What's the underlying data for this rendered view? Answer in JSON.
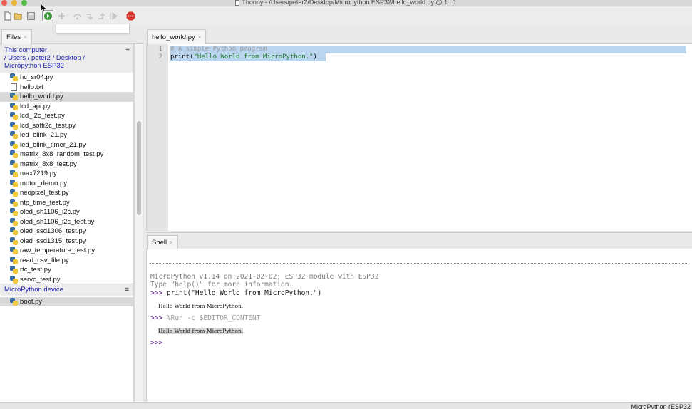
{
  "window": {
    "title": "Thonny  -  /Users/peter2/Desktop/Micropython ESP32/hello_world.py  @  1 : 1"
  },
  "toolbar": {
    "buttons": [
      "new-file-icon",
      "open-file-icon",
      "save-icon",
      "run-icon",
      "debug-icon",
      "step-over-icon",
      "step-into-icon",
      "step-out-icon",
      "resume-icon",
      "stop-icon"
    ],
    "stop_label": "STOP"
  },
  "files_panel": {
    "tab_label": "Files",
    "close_glyph": "×",
    "menu_glyph": "≡",
    "this_computer": "This computer",
    "path": "/ Users / peter2 / Desktop /",
    "path2": "Micropython ESP32",
    "files": [
      {
        "name": "hc_sr04.py",
        "type": "py"
      },
      {
        "name": "hello.txt",
        "type": "txt"
      },
      {
        "name": "hello_world.py",
        "type": "py",
        "selected": true
      },
      {
        "name": "lcd_api.py",
        "type": "py"
      },
      {
        "name": "lcd_i2c_test.py",
        "type": "py"
      },
      {
        "name": "lcd_softi2c_test.py",
        "type": "py"
      },
      {
        "name": "led_blink_21.py",
        "type": "py"
      },
      {
        "name": "led_blink_timer_21.py",
        "type": "py"
      },
      {
        "name": "matrix_8x8_random_test.py",
        "type": "py"
      },
      {
        "name": "matrix_8x8_test.py",
        "type": "py"
      },
      {
        "name": "max7219.py",
        "type": "py"
      },
      {
        "name": "motor_demo.py",
        "type": "py"
      },
      {
        "name": "neopixel_test.py",
        "type": "py"
      },
      {
        "name": "ntp_time_test.py",
        "type": "py"
      },
      {
        "name": "oled_sh1106_i2c.py",
        "type": "py"
      },
      {
        "name": "oled_sh1106_i2c_test.py",
        "type": "py"
      },
      {
        "name": "oled_ssd1306_test.py",
        "type": "py"
      },
      {
        "name": "oled_ssd1315_test.py",
        "type": "py"
      },
      {
        "name": "raw_temperature_test.py",
        "type": "py"
      },
      {
        "name": "read_csv_file.py",
        "type": "py"
      },
      {
        "name": "rtc_test.py",
        "type": "py"
      },
      {
        "name": "servo_test.py",
        "type": "py"
      }
    ],
    "device_title": "MicroPython device",
    "device_files": [
      "boot.py"
    ]
  },
  "editor": {
    "tab_label": "hello_world.py",
    "line_numbers": [
      "1",
      "2"
    ],
    "line1": "# A simple Python program",
    "line2_fn": "print(",
    "line2_str": "\"Hello World from MicroPython.\"",
    "line2_end": ")"
  },
  "shell": {
    "tab_label": "Shell",
    "banner1": "MicroPython v1.14 on 2021-02-02; ESP32 module with ESP32",
    "banner2": "Type \"help()\" for more information.",
    "prompt": ">>>",
    "cmd1": " print(\"Hello World from MicroPython.\")",
    "out1": "Hello World from MicroPython.",
    "cmd2": " %Run -c $EDITOR_CONTENT",
    "out2": "Hello World from MicroPython."
  },
  "status_bar": {
    "backend": "MicroPython (ESP32"
  },
  "colors": {
    "selection": "#bcd5ef",
    "prompt": "#5b178c",
    "path_link": "#1b1fa8",
    "stop_red": "#d9302a",
    "run_green": "#3a9a3a"
  }
}
